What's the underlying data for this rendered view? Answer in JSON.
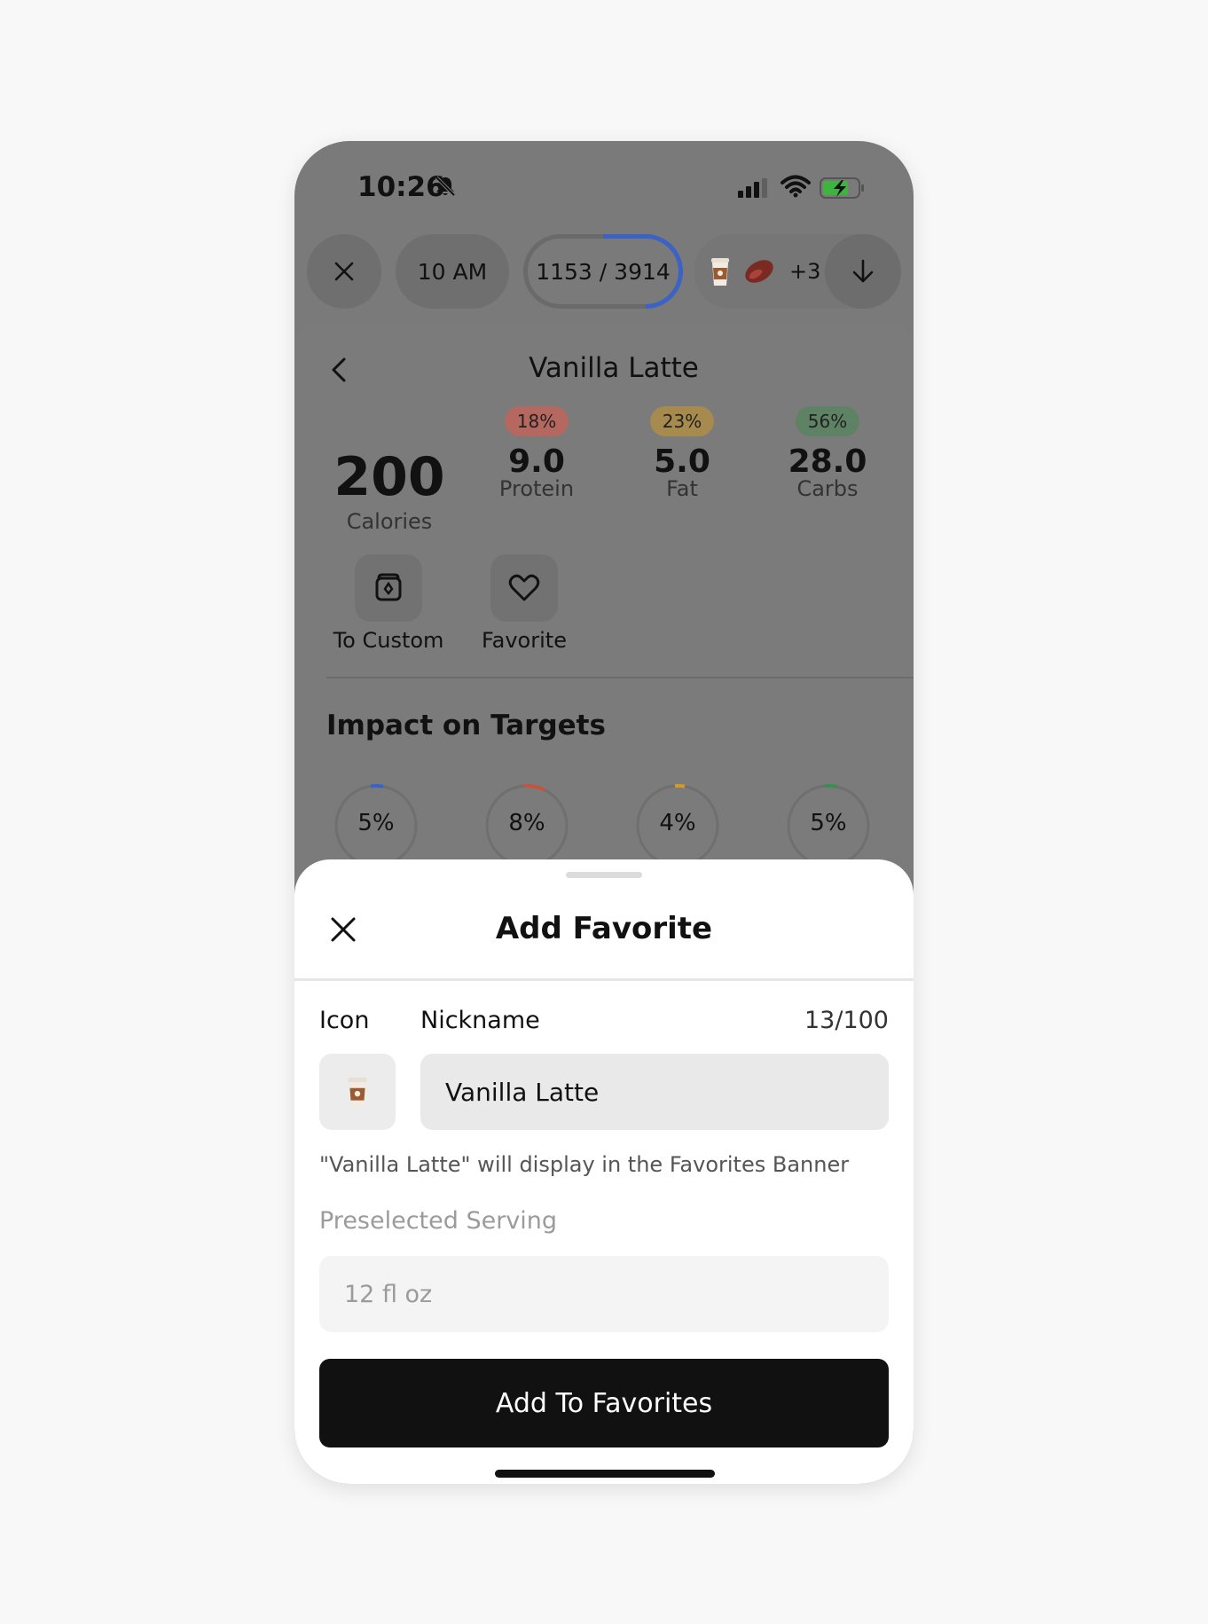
{
  "status_bar": {
    "time": "10:26"
  },
  "top_bar": {
    "time_chip": "10 AM",
    "calorie_progress_text": "1153 / 3914",
    "calorie_progress_fraction": 0.2946,
    "foods_more_count": "+3"
  },
  "food_detail": {
    "title": "Vanilla Latte",
    "calories": {
      "value": "200",
      "label": "Calories"
    },
    "macros": [
      {
        "percent": "18%",
        "value": "9.0",
        "label": "Protein",
        "badge_color": "#b5685f"
      },
      {
        "percent": "23%",
        "value": "5.0",
        "label": "Fat",
        "badge_color": "#a68a4e"
      },
      {
        "percent": "56%",
        "value": "28.0",
        "label": "Carbs",
        "badge_color": "#5e8264"
      }
    ],
    "actions": [
      {
        "label": "To Custom",
        "icon": "custom-food-icon"
      },
      {
        "label": "Favorite",
        "icon": "heart-icon"
      }
    ],
    "impact": {
      "title": "Impact on Targets",
      "rings": [
        {
          "text": "5%",
          "color": "#3b63c6"
        },
        {
          "text": "8%",
          "color": "#c4553c"
        },
        {
          "text": "4%",
          "color": "#d19a2c"
        },
        {
          "text": "5%",
          "color": "#3c8c55"
        }
      ]
    }
  },
  "sheet": {
    "title": "Add Favorite",
    "icon_label": "Icon",
    "nickname_label": "Nickname",
    "char_count": "13/100",
    "nickname_value": "Vanilla Latte",
    "hint": "\"Vanilla Latte\" will display in the Favorites Banner",
    "serving_label": "Preselected Serving",
    "serving_value": "12 fl oz",
    "submit_label": "Add To Favorites"
  }
}
